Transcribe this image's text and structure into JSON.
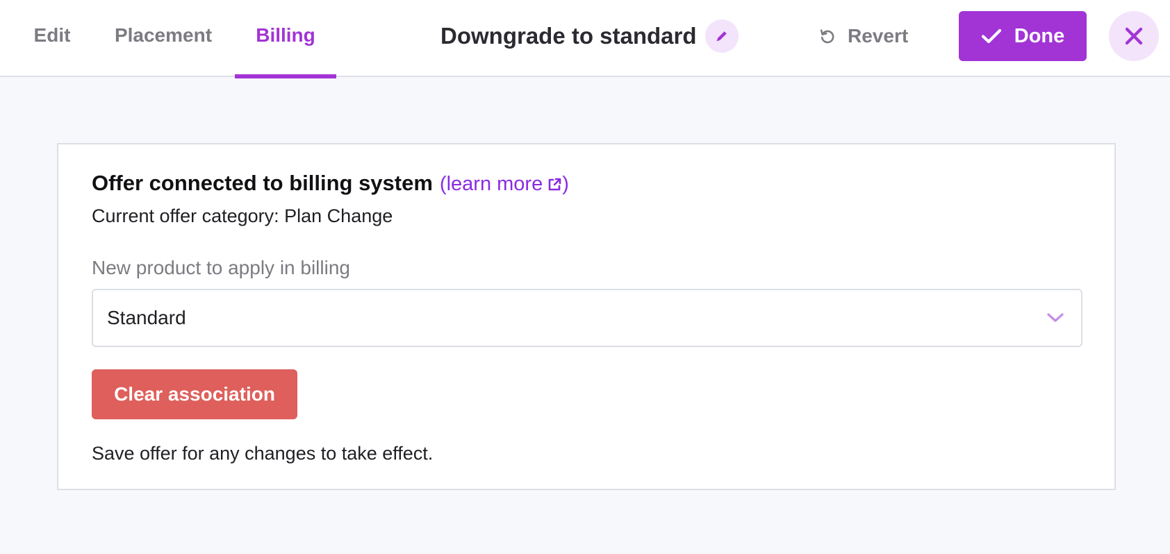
{
  "tabs": [
    {
      "label": "Edit",
      "active": false
    },
    {
      "label": "Placement",
      "active": false
    },
    {
      "label": "Billing",
      "active": true
    }
  ],
  "header": {
    "title": "Downgrade to standard",
    "revert_label": "Revert",
    "done_label": "Done"
  },
  "icons": {
    "edit": "pencil-icon",
    "revert": "revert-icon",
    "done": "check-icon",
    "close": "close-icon",
    "external": "external-link-icon",
    "dropdown": "chevron-down-icon"
  },
  "colors": {
    "accent": "#a234d6",
    "link": "#8a2be2",
    "danger": "#de5f5b",
    "accent_soft": "#f3e4fb"
  },
  "billing": {
    "heading": "Offer connected to billing system",
    "learn_more_open": "(",
    "learn_more_label": "learn more",
    "learn_more_close": ")",
    "category_text": "Current offer category: Plan Change",
    "product_label": "New product to apply in billing",
    "product_value": "Standard",
    "clear_label": "Clear association",
    "save_note": "Save offer for any changes to take effect."
  }
}
